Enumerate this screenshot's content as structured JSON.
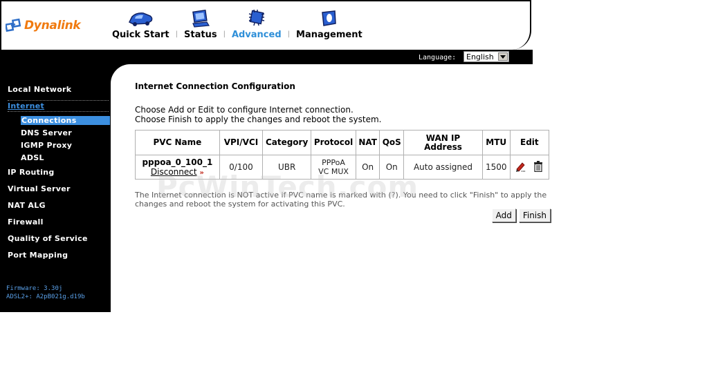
{
  "header": {
    "logo_text": "Dynalink",
    "nav": [
      {
        "label": "Quick Start",
        "icon": "car-icon",
        "active": false
      },
      {
        "label": "Status",
        "icon": "monitor-icon",
        "active": false
      },
      {
        "label": "Advanced",
        "icon": "chip-icon",
        "active": true
      },
      {
        "label": "Management",
        "icon": "shield-icon",
        "active": false
      }
    ],
    "nav_separator": "|",
    "language_label": "Language:",
    "language_value": "English"
  },
  "sidebar": {
    "items": [
      {
        "label": "Local Network"
      },
      {
        "label": "Internet"
      },
      {
        "label": "IP Routing"
      },
      {
        "label": "Virtual Server"
      },
      {
        "label": "NAT ALG"
      },
      {
        "label": "Firewall"
      },
      {
        "label": "Quality of Service"
      },
      {
        "label": "Port Mapping"
      }
    ],
    "internet_sub": [
      {
        "label": "Connections"
      },
      {
        "label": "DNS Server"
      },
      {
        "label": "IGMP Proxy"
      },
      {
        "label": "ADSL"
      }
    ],
    "firmware": "Firmware: 3.30j",
    "adsl": "ADSL2+: A2pB021g.d19b"
  },
  "main": {
    "title": "Internet Connection Configuration",
    "instruction_1": "Choose Add or Edit to configure Internet connection.",
    "instruction_2": "Choose Finish to apply the changes and reboot the system.",
    "table": {
      "headers": [
        "PVC Name",
        "VPI/VCI",
        "Category",
        "Protocol",
        "NAT",
        "QoS",
        "WAN IP Address",
        "MTU",
        "Edit"
      ],
      "row": {
        "pvc_name": "pppoa_0_100_1",
        "disconnect": "Disconnect",
        "vpi_vci": "0/100",
        "category": "UBR",
        "protocol_1": "PPPoA",
        "protocol_2": "VC MUX",
        "nat": "On",
        "qos": "On",
        "wan_ip": "Auto assigned",
        "mtu": "1500"
      }
    },
    "note": "The Internet connection is NOT active if PVC name is marked with (?). You need to click \"Finish\" to apply the changes and reboot the system for activating this PVC.",
    "add_label": "Add",
    "finish_label": "Finish"
  },
  "watermark": "PcWinTech.com",
  "colors": {
    "accent": "#3c8fe0",
    "logo": "#f07a10"
  }
}
